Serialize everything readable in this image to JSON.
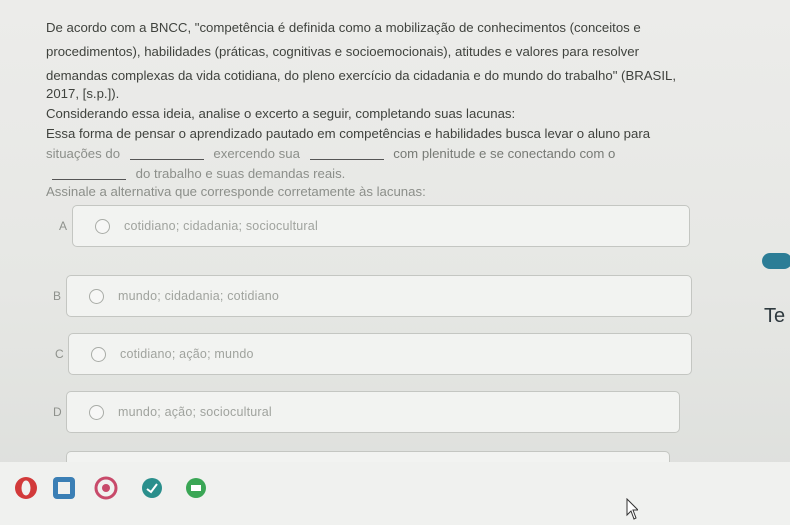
{
  "question": {
    "lines": [
      "De acordo com a BNCC, \"competência é definida como a mobilização de conhecimentos (conceitos e",
      "procedimentos), habilidades (práticas, cognitivas e socioemocionais), atitudes e valores para resolver",
      "demandas complexas da vida cotidiana, do pleno exercício da cidadania e do mundo do trabalho\" (BRASIL,",
      "2017, [s.p.]).",
      "Considerando essa ideia, analise o excerto a seguir, completando suas lacunas:",
      "Essa forma de pensar o aprendizado pautado em competências e habilidades busca levar o aluno para",
      "situações do",
      "exercendo sua",
      "com plenitude e se conectando com o",
      "do trabalho e suas demandas reais.",
      "Assinale a alternativa que corresponde corretamente às lacunas:"
    ]
  },
  "options": [
    {
      "letter": "A",
      "text": "cotidiano; cidadania; sociocultural"
    },
    {
      "letter": "B",
      "text": "mundo; cidadania; cotidiano"
    },
    {
      "letter": "C",
      "text": "cotidiano; ação; mundo"
    },
    {
      "letter": "D",
      "text": "mundo; ação; sociocultural"
    }
  ],
  "side": {
    "partial_text": "Te"
  },
  "taskbar": {
    "icons": [
      {
        "name": "opera-icon",
        "color": "#d23a3a"
      },
      {
        "name": "app-icon-blue",
        "color": "#3b7fb5"
      },
      {
        "name": "app-icon-red-ring",
        "color": "#c84a6a"
      },
      {
        "name": "app-icon-teal",
        "color": "#2a8f8c"
      },
      {
        "name": "app-icon-green",
        "color": "#3aa655"
      }
    ]
  }
}
